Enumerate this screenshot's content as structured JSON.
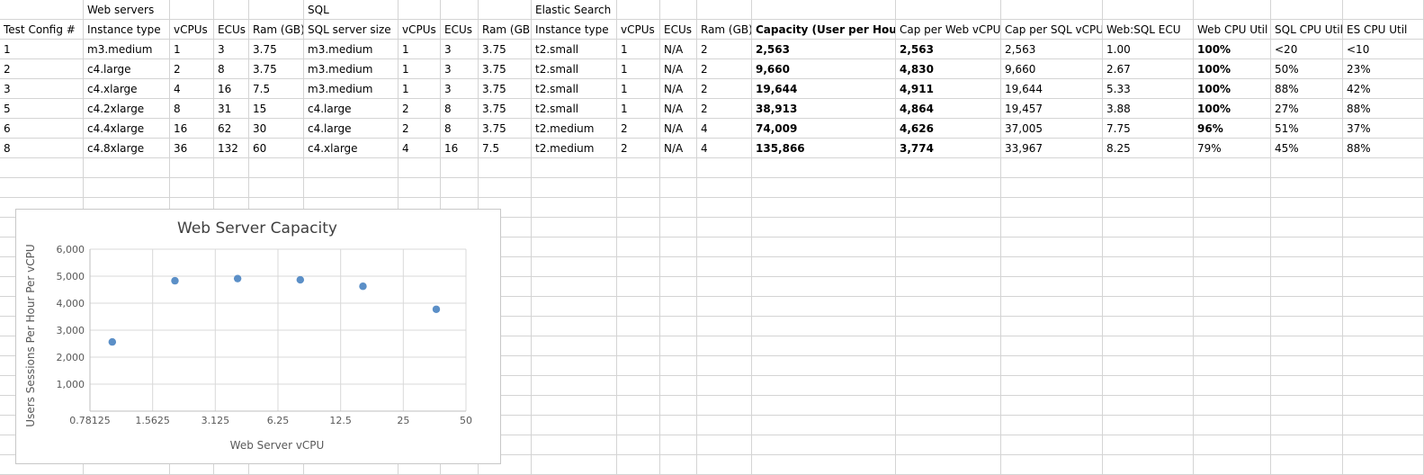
{
  "group_headers": [
    "",
    "Web servers",
    "SQL",
    "Elastic Search"
  ],
  "columns": [
    "Test Config #",
    "Instance type",
    "vCPUs",
    "ECUs",
    "Ram (GB)",
    "SQL server size",
    "vCPUs",
    "ECUs",
    "Ram (GB)",
    "Instance type",
    "vCPUs",
    "ECUs",
    "Ram (GB)",
    "Capacity (User per Hour)",
    "Cap per Web vCPU",
    "Cap per SQL vCPU",
    "Web:SQL ECU",
    "Web CPU Util",
    "SQL CPU Util",
    "ES CPU Util"
  ],
  "rows": [
    [
      "1",
      "m3.medium",
      "1",
      "3",
      "3.75",
      "m3.medium",
      "1",
      "3",
      "3.75",
      "t2.small",
      "1",
      "N/A",
      "2",
      "2,563",
      "2,563",
      "2,563",
      "1.00",
      "100%",
      "<20",
      "<10"
    ],
    [
      "2",
      "c4.large",
      "2",
      "8",
      "3.75",
      "m3.medium",
      "1",
      "3",
      "3.75",
      "t2.small",
      "1",
      "N/A",
      "2",
      "9,660",
      "4,830",
      "9,660",
      "2.67",
      "100%",
      "50%",
      "23%"
    ],
    [
      "3",
      "c4.xlarge",
      "4",
      "16",
      "7.5",
      "m3.medium",
      "1",
      "3",
      "3.75",
      "t2.small",
      "1",
      "N/A",
      "2",
      "19,644",
      "4,911",
      "19,644",
      "5.33",
      "100%",
      "88%",
      "42%"
    ],
    [
      "5",
      "c4.2xlarge",
      "8",
      "31",
      "15",
      "c4.large",
      "2",
      "8",
      "3.75",
      "t2.small",
      "1",
      "N/A",
      "2",
      "38,913",
      "4,864",
      "19,457",
      "3.88",
      "100%",
      "27%",
      "88%"
    ],
    [
      "6",
      "c4.4xlarge",
      "16",
      "62",
      "30",
      "c4.large",
      "2",
      "8",
      "3.75",
      "t2.medium",
      "2",
      "N/A",
      "4",
      "74,009",
      "4,626",
      "37,005",
      "7.75",
      "96%",
      "51%",
      "37%"
    ],
    [
      "8",
      "c4.8xlarge",
      "36",
      "132",
      "60",
      "c4.xlarge",
      "4",
      "16",
      "7.5",
      "t2.medium",
      "2",
      "N/A",
      "4",
      "135,866",
      "3,774",
      "33,967",
      "8.25",
      "79%",
      "45%",
      "88%"
    ]
  ],
  "chart_data": {
    "type": "scatter",
    "title": "Web Server Capacity",
    "xlabel": "Web Server vCPU",
    "ylabel": "Users Sessions Per Hour Per vCPU",
    "x_scale": "log2",
    "x_ticks": [
      "0.78125",
      "1.5625",
      "3.125",
      "6.25",
      "12.5",
      "25",
      "50"
    ],
    "y_ticks": [
      "1,000",
      "2,000",
      "3,000",
      "4,000",
      "5,000",
      "6,000"
    ],
    "xlim": [
      0.78125,
      50
    ],
    "ylim": [
      0,
      6000
    ],
    "grid": true,
    "marker_color": "#5b8fc7",
    "points": [
      {
        "x": 1,
        "y": 2563
      },
      {
        "x": 2,
        "y": 4830
      },
      {
        "x": 4,
        "y": 4911
      },
      {
        "x": 8,
        "y": 4864
      },
      {
        "x": 16,
        "y": 4626
      },
      {
        "x": 36,
        "y": 3774
      }
    ]
  }
}
